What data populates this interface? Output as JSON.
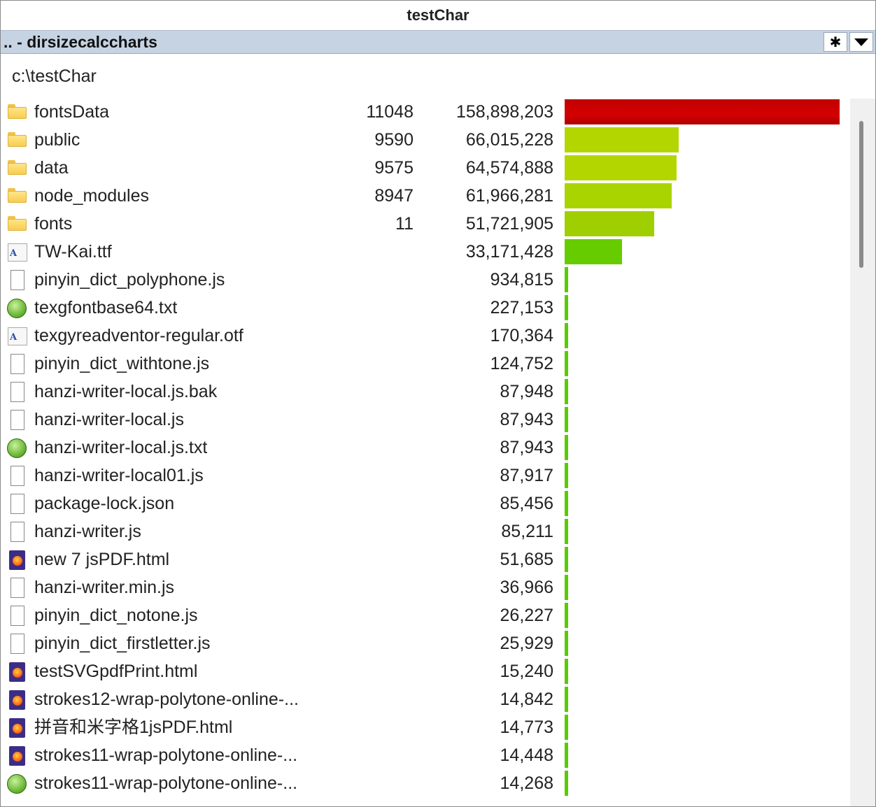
{
  "window": {
    "title": "testChar"
  },
  "pathbar": {
    "crumb": ".. - dirsizecalccharts",
    "options_icon": "asterisk-icon",
    "dropdown_icon": "chevron-down-icon"
  },
  "current_dir": "c:\\testChar",
  "colors": {
    "bar_top": "#c00000",
    "bar_high": "#b4d600",
    "bar_mid": "#9fcf00",
    "bar_low": "#66cc00",
    "bar_min": "#55cc00"
  },
  "items": [
    {
      "icon": "folder",
      "name": "fontsData",
      "count": "11048",
      "size": "158,898,203",
      "fraction": 1.0,
      "color": "#c00000"
    },
    {
      "icon": "folder",
      "name": "public",
      "count": "9590",
      "size": "66,015,228",
      "fraction": 0.4155,
      "color": "#b4d600"
    },
    {
      "icon": "folder",
      "name": "data",
      "count": "9575",
      "size": "64,574,888",
      "fraction": 0.4064,
      "color": "#b4d600"
    },
    {
      "icon": "folder",
      "name": "node_modules",
      "count": "8947",
      "size": "61,966,281",
      "fraction": 0.39,
      "color": "#aad400"
    },
    {
      "icon": "folder",
      "name": "fonts",
      "count": "11",
      "size": "51,721,905",
      "fraction": 0.3255,
      "color": "#9fcf00"
    },
    {
      "icon": "font",
      "name": "TW-Kai.ttf",
      "count": "",
      "size": "33,171,428",
      "fraction": 0.2088,
      "color": "#66cc00"
    },
    {
      "icon": "file",
      "name": "pinyin_dict_polyphone.js",
      "count": "",
      "size": "934,815",
      "fraction": 0.0059,
      "color": "#55cc00"
    },
    {
      "icon": "text",
      "name": "texgfontbase64.txt",
      "count": "",
      "size": "227,153",
      "fraction": 0.0014,
      "color": "#55cc00"
    },
    {
      "icon": "font",
      "name": "texgyreadventor-regular.otf",
      "count": "",
      "size": "170,364",
      "fraction": 0.0011,
      "color": "#55cc00"
    },
    {
      "icon": "file",
      "name": "pinyin_dict_withtone.js",
      "count": "",
      "size": "124,752",
      "fraction": 0.0008,
      "color": "#55cc00"
    },
    {
      "icon": "file",
      "name": "hanzi-writer-local.js.bak",
      "count": "",
      "size": "87,948",
      "fraction": 0.0006,
      "color": "#55cc00"
    },
    {
      "icon": "file",
      "name": "hanzi-writer-local.js",
      "count": "",
      "size": "87,943",
      "fraction": 0.0006,
      "color": "#55cc00"
    },
    {
      "icon": "text",
      "name": "hanzi-writer-local.js.txt",
      "count": "",
      "size": "87,943",
      "fraction": 0.0006,
      "color": "#55cc00"
    },
    {
      "icon": "file",
      "name": "hanzi-writer-local01.js",
      "count": "",
      "size": "87,917",
      "fraction": 0.0006,
      "color": "#55cc00"
    },
    {
      "icon": "file",
      "name": "package-lock.json",
      "count": "",
      "size": "85,456",
      "fraction": 0.0005,
      "color": "#55cc00"
    },
    {
      "icon": "file",
      "name": "hanzi-writer.js",
      "count": "",
      "size": "85,211",
      "fraction": 0.0005,
      "color": "#55cc00"
    },
    {
      "icon": "html",
      "name": "new 7 jsPDF.html",
      "count": "",
      "size": "51,685",
      "fraction": 0.0003,
      "color": "#55cc00"
    },
    {
      "icon": "file",
      "name": "hanzi-writer.min.js",
      "count": "",
      "size": "36,966",
      "fraction": 0.0002,
      "color": "#55cc00"
    },
    {
      "icon": "file",
      "name": "pinyin_dict_notone.js",
      "count": "",
      "size": "26,227",
      "fraction": 0.0002,
      "color": "#55cc00"
    },
    {
      "icon": "file",
      "name": "pinyin_dict_firstletter.js",
      "count": "",
      "size": "25,929",
      "fraction": 0.0002,
      "color": "#55cc00"
    },
    {
      "icon": "html",
      "name": "testSVGpdfPrint.html",
      "count": "",
      "size": "15,240",
      "fraction": 0.0001,
      "color": "#55cc00"
    },
    {
      "icon": "html",
      "name": "strokes12-wrap-polytone-online-...",
      "count": "",
      "size": "14,842",
      "fraction": 0.0001,
      "color": "#55cc00"
    },
    {
      "icon": "html",
      "name": "拼音和米字格1jsPDF.html",
      "count": "",
      "size": "14,773",
      "fraction": 0.0001,
      "color": "#55cc00"
    },
    {
      "icon": "html",
      "name": "strokes11-wrap-polytone-online-...",
      "count": "",
      "size": "14,448",
      "fraction": 0.0001,
      "color": "#55cc00"
    },
    {
      "icon": "text",
      "name": "strokes11-wrap-polytone-online-...",
      "count": "",
      "size": "14,268",
      "fraction": 0.0001,
      "color": "#55cc00"
    }
  ]
}
